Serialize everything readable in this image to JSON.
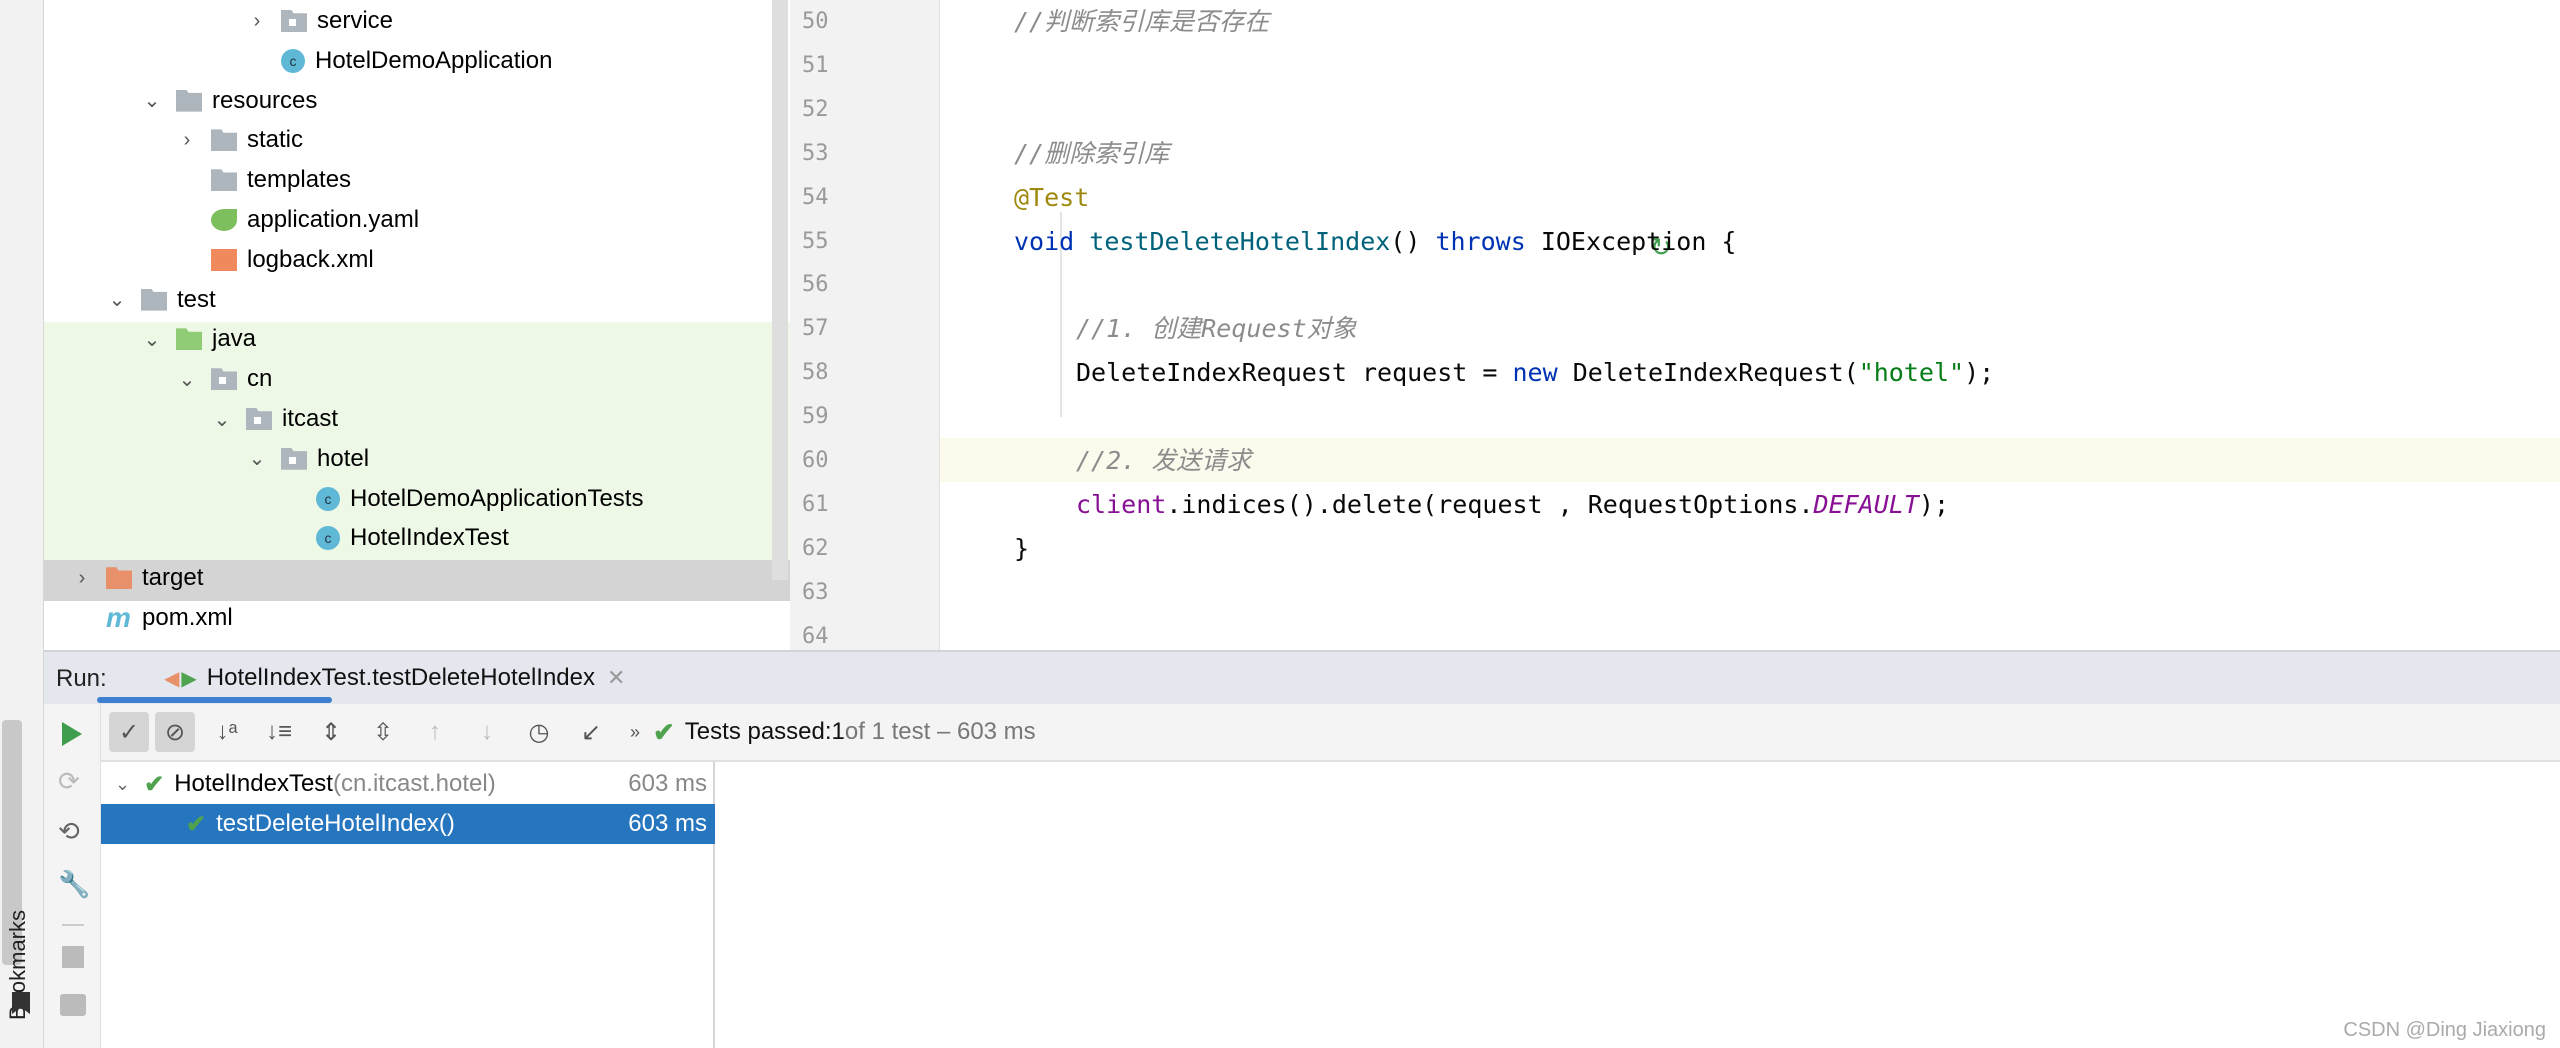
{
  "project_tree": [
    {
      "label": "service",
      "icon": "package-folder-icon",
      "expander": "collapsed",
      "indent": 5
    },
    {
      "label": "HotelDemoApplication",
      "icon": "spring-boot-class-icon",
      "expander": "none",
      "indent": 5
    },
    {
      "label": "resources",
      "icon": "resources-folder-icon",
      "expander": "expanded",
      "indent": 2
    },
    {
      "label": "static",
      "icon": "folder-icon",
      "expander": "collapsed",
      "indent": 3
    },
    {
      "label": "templates",
      "icon": "folder-icon",
      "expander": "none",
      "indent": 3
    },
    {
      "label": "application.yaml",
      "icon": "spring-yaml-icon",
      "expander": "none",
      "indent": 3
    },
    {
      "label": "logback.xml",
      "icon": "xml-file-icon",
      "expander": "none",
      "indent": 3
    },
    {
      "label": "test",
      "icon": "folder-icon",
      "expander": "expanded",
      "indent": 1
    },
    {
      "label": "java",
      "icon": "test-root-folder-icon",
      "expander": "expanded",
      "indent": 2
    },
    {
      "label": "cn",
      "icon": "package-folder-icon",
      "expander": "expanded",
      "indent": 3
    },
    {
      "label": "itcast",
      "icon": "package-folder-icon",
      "expander": "expanded",
      "indent": 4
    },
    {
      "label": "hotel",
      "icon": "package-folder-icon",
      "expander": "expanded",
      "indent": 5
    },
    {
      "label": "HotelDemoApplicationTests",
      "icon": "test-class-icon",
      "expander": "none",
      "indent": 6
    },
    {
      "label": "HotelIndexTest",
      "icon": "test-class-icon",
      "expander": "none",
      "indent": 6
    },
    {
      "label": "target",
      "icon": "excluded-folder-icon",
      "expander": "collapsed",
      "indent": 0
    },
    {
      "label": "pom.xml",
      "icon": "maven-icon",
      "expander": "none",
      "indent": 0
    }
  ],
  "editor": {
    "current_line": "60",
    "lines": [
      {
        "n": "50",
        "tokens": [
          [
            "cm",
            "//判断索引库是否存在"
          ]
        ],
        "indent": 0
      },
      {
        "n": "51",
        "tokens": [],
        "indent": 0
      },
      {
        "n": "52",
        "tokens": [],
        "indent": 0
      },
      {
        "n": "53",
        "tokens": [
          [
            "cm",
            "//删除索引库"
          ]
        ],
        "indent": 0
      },
      {
        "n": "54",
        "tokens": [
          [
            "an",
            "@Test"
          ]
        ],
        "indent": 0
      },
      {
        "n": "55",
        "tokens": [
          [
            "kw",
            "void "
          ],
          [
            "fn",
            "testDeleteHotelIndex"
          ],
          [
            "",
            "() "
          ],
          [
            "kw",
            "throws "
          ],
          [
            "",
            "IOException {"
          ]
        ],
        "indent": 0
      },
      {
        "n": "56",
        "tokens": [],
        "indent": 1
      },
      {
        "n": "57",
        "tokens": [
          [
            "cm",
            "//1. 创建Request对象"
          ]
        ],
        "indent": 1
      },
      {
        "n": "58",
        "tokens": [
          [
            "",
            "DeleteIndexRequest request = "
          ],
          [
            "kw",
            "new "
          ],
          [
            "",
            "DeleteIndexRequest("
          ],
          [
            "st",
            "\"hotel\""
          ],
          [
            "",
            ");"
          ]
        ],
        "indent": 1
      },
      {
        "n": "59",
        "tokens": [],
        "indent": 1
      },
      {
        "n": "60",
        "tokens": [
          [
            "cm",
            "//2. 发送请求"
          ]
        ],
        "indent": 1
      },
      {
        "n": "61",
        "tokens": [
          [
            "fd",
            "client"
          ],
          [
            "",
            ".indices().delete(request , RequestOptions."
          ],
          [
            "sf",
            "DEFAULT"
          ],
          [
            "",
            ");"
          ]
        ],
        "indent": 1
      },
      {
        "n": "62",
        "tokens": [
          [
            "",
            "}"
          ]
        ],
        "indent": 0
      },
      {
        "n": "63",
        "tokens": [],
        "indent": 0
      },
      {
        "n": "64",
        "tokens": [],
        "indent": 0
      }
    ]
  },
  "run": {
    "label": "Run:",
    "tab_label": "HotelIndexTest.testDeleteHotelIndex",
    "status_prefix": "Tests passed: ",
    "status_count": "1",
    "status_suffix": " of 1 test – 603 ms",
    "tests": [
      {
        "name": "HotelIndexTest",
        "package": " (cn.itcast.hotel)",
        "time": "603 ms",
        "selected": false
      },
      {
        "name": "testDeleteHotelIndex()",
        "package": "",
        "time": "603 ms",
        "selected": true
      }
    ]
  },
  "sidebar": {
    "bookmarks_label": "Bookmarks"
  },
  "watermark": "CSDN @Ding Jiaxiong",
  "colors": {
    "accent": "#2675bf",
    "test_pass": "#4fa34f",
    "test_scope_bg": "#eef8e6",
    "current_line_bg": "#fcfaed"
  }
}
